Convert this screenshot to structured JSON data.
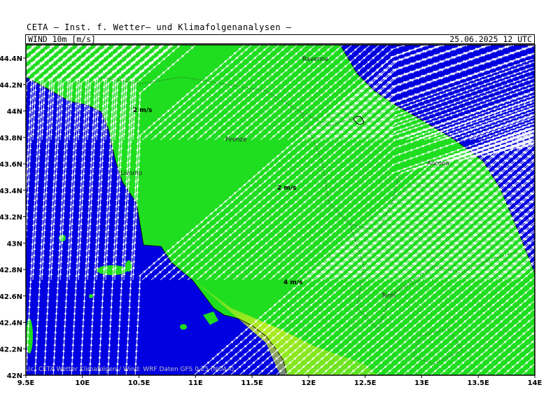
{
  "header": {
    "title": "CETA — Inst. f. Wetter— und Klimafolgenanalysen —",
    "variable": "WIND 10m [m/s]",
    "valid_time": "25.06.2025 12 UTC"
  },
  "axes": {
    "x_ticks": [
      "9.5E",
      "10E",
      "10.5E",
      "11E",
      "11.5E",
      "12E",
      "12.5E",
      "13E",
      "13.5E",
      "14E"
    ],
    "y_ticks": [
      "44.4N",
      "44.2N",
      "44N",
      "43.8N",
      "43.6N",
      "43.4N",
      "43.2N",
      "43N",
      "42.8N",
      "42.6N",
      "42.4N",
      "42.2N",
      "42N"
    ],
    "lon_range": [
      9.5,
      14
    ],
    "lat_range": [
      42,
      44.5
    ]
  },
  "cities": [
    {
      "name": "Ravenna"
    },
    {
      "name": "Firenze"
    },
    {
      "name": "Livorno"
    },
    {
      "name": "Ancona"
    },
    {
      "name": "Terni"
    }
  ],
  "contour_labels": [
    {
      "text": "2 m/s"
    },
    {
      "text": "2 m/s"
    },
    {
      "text": "4 m/s"
    }
  ],
  "copyright": "(c) CETA Wetter Klimafolgen / Wind: WRF Daten GFS 0.25 (NOAA)",
  "colors": {
    "low_wind": "#0000e0",
    "mid_wind": "#22dd22",
    "high_wind": "#ccee22",
    "streamline": "#ffffff"
  }
}
